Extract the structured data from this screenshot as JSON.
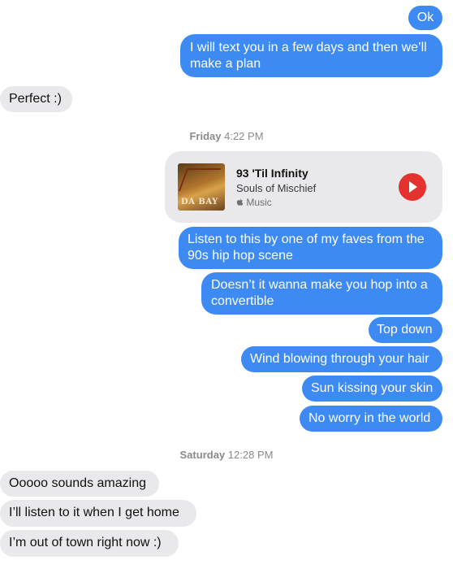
{
  "messages": {
    "ok": "Ok",
    "text_plan": "I will text you in a few days and then we’ll make a plan",
    "perfect": "Perfect :)",
    "listen": "Listen to this by one of my faves from the 90s hip hop scene",
    "convertible": "Doesn’t it wanna make you hop into a convertible",
    "top_down": "Top down",
    "wind": "Wind blowing through your hair",
    "sun": "Sun kissing your skin",
    "no_worry": "No worry in the world",
    "amazing": "Ooooo sounds amazing",
    "listen_home": "I’ll listen to it when I get home",
    "out_of_town": "I’m out of town right now :)"
  },
  "timestamps": {
    "friday_day": "Friday",
    "friday_time": "4:22 PM",
    "saturday_day": "Saturday",
    "saturday_time": "12:28 PM"
  },
  "music_card": {
    "title": "93 'Til Infinity",
    "artist": "Souls of Mischief",
    "source": "Music",
    "album_art_text": "DA BAY",
    "play_icon": "play-icon",
    "accent_color": "#e3322f"
  },
  "colors": {
    "sent_bubble": "#3e8af3",
    "received_bubble": "#e9e9eb"
  }
}
